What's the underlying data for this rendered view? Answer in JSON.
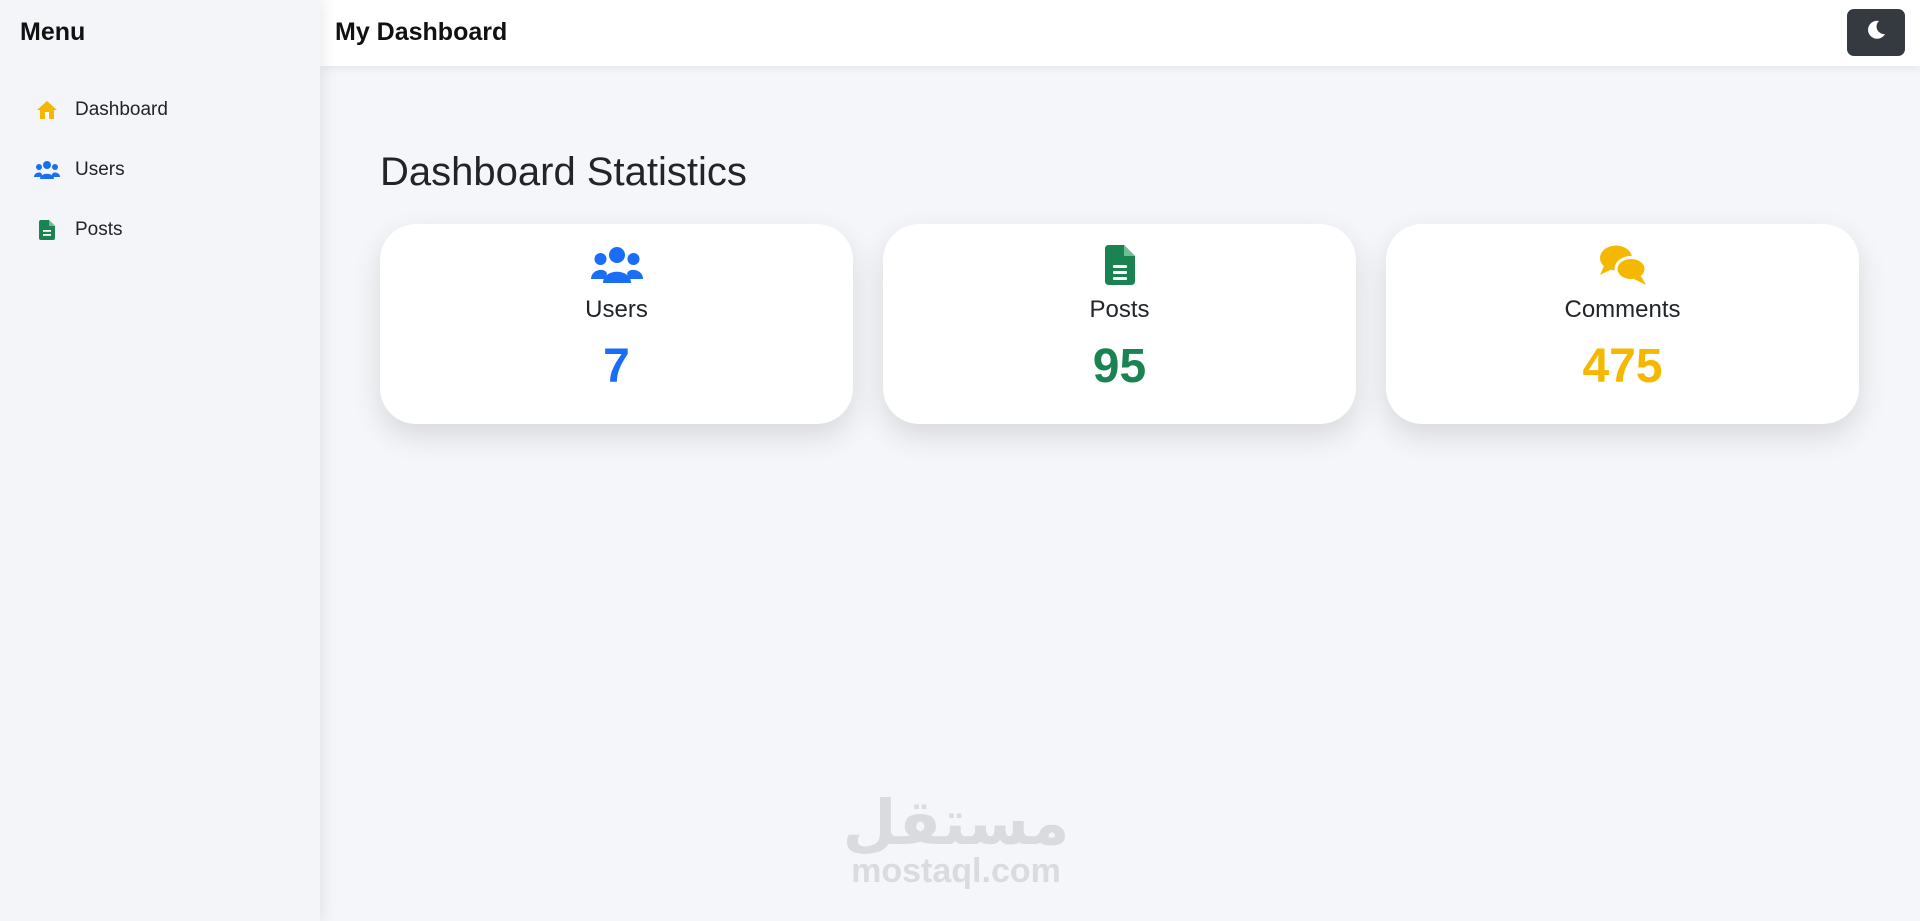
{
  "sidebar": {
    "title": "Menu",
    "items": [
      {
        "label": "Dashboard",
        "icon": "home-icon",
        "color": "#f5b800"
      },
      {
        "label": "Users",
        "icon": "users-icon",
        "color": "#1a6ef5"
      },
      {
        "label": "Posts",
        "icon": "file-icon",
        "color": "#1b8352"
      }
    ]
  },
  "header": {
    "title": "My Dashboard",
    "theme_toggle_icon": "moon-icon"
  },
  "main": {
    "title": "Dashboard Statistics",
    "cards": [
      {
        "label": "Users",
        "value": "7",
        "icon": "users-icon",
        "color": "#1a6ef5"
      },
      {
        "label": "Posts",
        "value": "95",
        "icon": "file-icon",
        "color": "#1b8352"
      },
      {
        "label": "Comments",
        "value": "475",
        "icon": "comments-icon",
        "color": "#f5b800"
      }
    ]
  },
  "watermark": {
    "arabic": "مستقل",
    "latin": "mostaql.com"
  }
}
